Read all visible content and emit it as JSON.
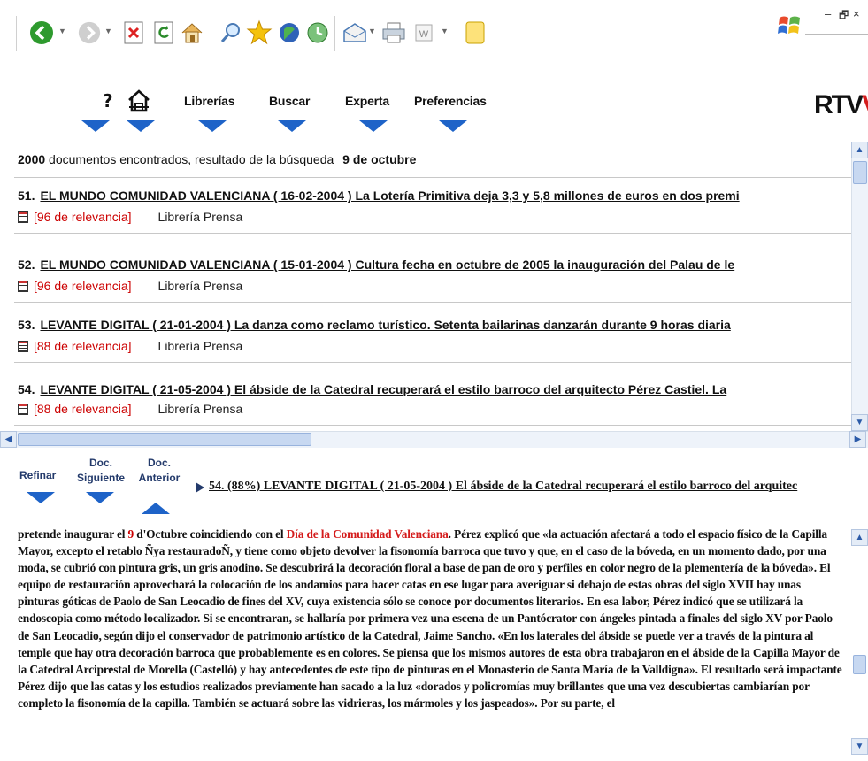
{
  "toolbar": {
    "icons": [
      "back-icon",
      "forward-icon",
      "stop-icon",
      "refresh-icon",
      "home-icon",
      "search-icon",
      "favorites-icon",
      "media-icon",
      "history-icon",
      "mail-icon",
      "print-icon",
      "edit-icon",
      "notes-icon"
    ],
    "window_controls": {
      "minimize": "–",
      "restore": "🗗",
      "close": "×"
    }
  },
  "nav": {
    "help_label": "?",
    "items": [
      "Librerías",
      "Buscar",
      "Experta",
      "Preferencias"
    ],
    "logo_text": "RTV",
    "logo_accent": "V"
  },
  "results": {
    "summary_count": "2000",
    "summary_text": "documentos encontrados,  resultado de la búsqueda",
    "summary_query": "9 de octubre",
    "items": [
      {
        "num": "51.",
        "title": "EL MUNDO COMUNIDAD VALENCIANA ( 16-02-2004 ) La Lotería Primitiva deja 3,3 y 5,8 millones de euros en dos premi",
        "relevance": "[96 de relevancia]",
        "library": "Librería Prensa"
      },
      {
        "num": "52.",
        "title": "EL MUNDO COMUNIDAD VALENCIANA ( 15-01-2004 ) Cultura fecha en octubre de 2005 la inauguración del Palau de le",
        "relevance": "[96 de relevancia]",
        "library": "Librería Prensa"
      },
      {
        "num": "53.",
        "title": "LEVANTE DIGITAL ( 21-01-2004 ) La danza como reclamo turístico. Setenta bailarinas danzarán durante 9 horas diaria",
        "relevance": "[88 de relevancia]",
        "library": "Librería Prensa"
      },
      {
        "num": "54.",
        "title": "LEVANTE DIGITAL ( 21-05-2004 ) El ábside de la Catedral recuperará el estilo barroco del arquitecto Pérez Castiel. La",
        "relevance": "[88 de relevancia]",
        "library": "Librería Prensa"
      }
    ]
  },
  "detail": {
    "refinar": "Refinar",
    "doc_siguiente_1": "Doc.",
    "doc_siguiente_2": "Siguiente",
    "doc_anterior_1": "Doc.",
    "doc_anterior_2": "Anterior",
    "title": "54. (88%) LEVANTE DIGITAL ( 21-05-2004 ) El ábside de la Catedral recuperará el estilo barroco del arquitec"
  },
  "body": {
    "p1": "pretende inaugurar el ",
    "num9": "9",
    "p2": " d'Octubre coincidiendo con el ",
    "red": "Día de la Comunidad Valenciana",
    "p3": ". Pérez explicó que «la actuación afectará a todo el espacio físico de la Capilla Mayor, excepto el retablo Ñya restauradoÑ, y tiene como objeto devolver la fisonomía barroca que tuvo y que, en el caso de la bóveda, en un momento dado, por una moda, se cubrió con pintura gris, un gris anodino. Se descubrirá la decoración floral a base de pan de oro y perfiles en color negro de la plementería de la bóveda». El equipo de restauración aprovechará la colocación de los andamios para hacer catas en ese lugar para averiguar si debajo de estas obras del siglo XVII hay unas pinturas góticas de Paolo de San Leocadio de fines del XV, cuya existencia sólo se conoce por documentos literarios. En esa labor, Pérez indicó que se utilizará la endoscopia como método localizador. Si se encontraran, se hallaría por primera vez una escena de un Pantócrator con ángeles pintada a finales del siglo XV por Paolo de San Leocadio, según dijo el conservador de patrimonio artístico de la Catedral, Jaime Sancho. «En los laterales del ábside se puede ver a través de la pintura al temple que hay otra decoración barroca que probablemente es en colores. Se piensa que los mismos autores de esta obra trabajaron en el ábside de la Capilla Mayor de la Catedral Arciprestal de Morella (Castelló) y hay antecedentes de este tipo de pinturas en el Monasterio de Santa María de la Valldigna». El resultado será impactante Pérez dijo que las catas y los estudios realizados previamente han sacado a la luz «dorados y policromías muy brillantes que una vez descubiertas cambiarían por completo la fisonomía de la capilla. También se actuará sobre las vidrieras, los mármoles y los jaspeados». Por su parte, el"
  },
  "colors": {
    "accent": "#1e63c8",
    "relevance": "#cc0000",
    "highlight": "#d41c1c"
  }
}
